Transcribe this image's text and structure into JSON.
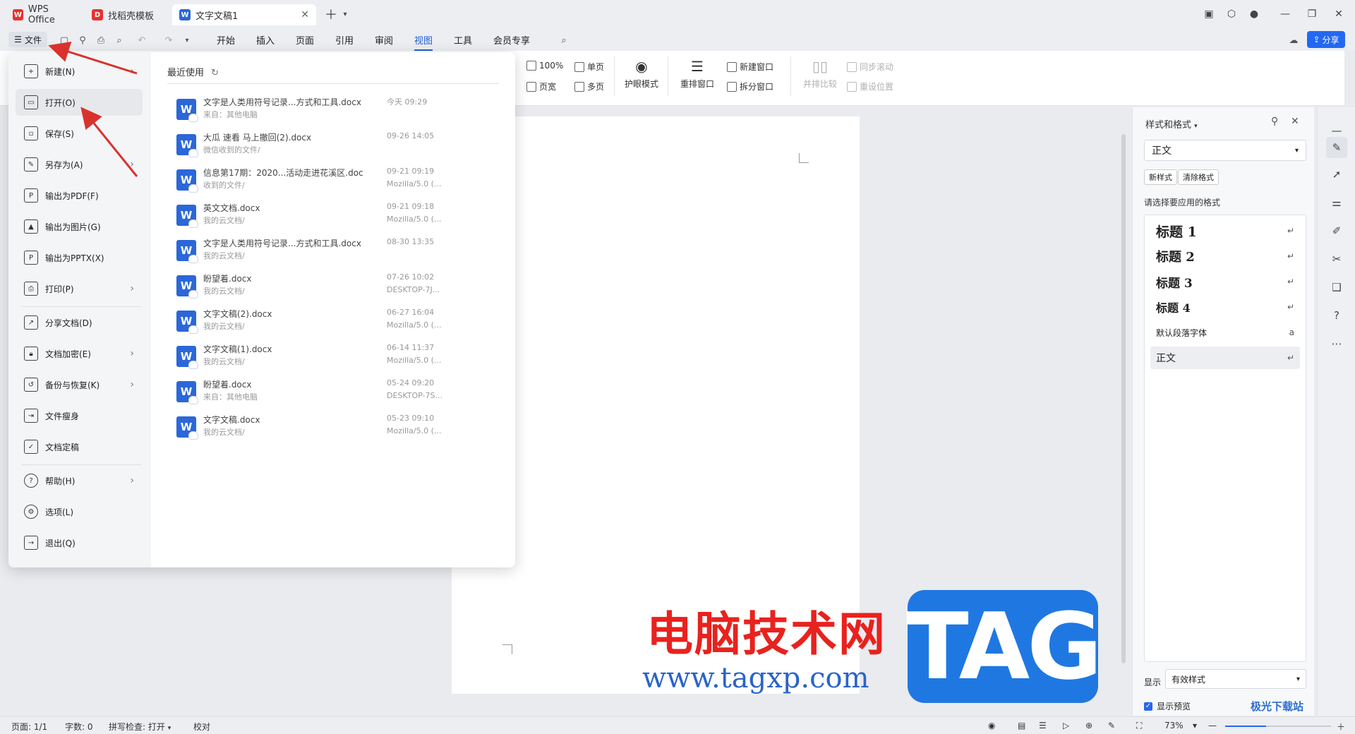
{
  "tabs": [
    {
      "label": "WPS Office",
      "icon": "wps-logo-icon"
    },
    {
      "label": "找稻壳模板",
      "icon": "docer-icon"
    },
    {
      "label": "文字文稿1",
      "icon": "word-doc-icon",
      "active": true
    }
  ],
  "menubar": {
    "file_label": "文件",
    "items": [
      "开始",
      "插入",
      "页面",
      "引用",
      "审阅",
      "视图",
      "工具",
      "会员专享"
    ],
    "active": "视图",
    "share_label": "分享"
  },
  "ribbon": {
    "zoom_100": "100%",
    "single_page": "单页",
    "page_width": "页宽",
    "multi_page": "多页",
    "eye_mode": "护眼模式",
    "rearrange_window": "重排窗口",
    "new_window": "新建窗口",
    "split_window": "拆分窗口",
    "side_by_side": "并排比较",
    "sync_scroll": "同步滚动",
    "reset_position": "重设位置"
  },
  "file_menu": {
    "items": [
      {
        "label": "新建(N)",
        "icon": "new-doc-icon",
        "arrow": true
      },
      {
        "label": "打开(O)",
        "icon": "folder-open-icon",
        "arrow": false
      },
      {
        "label": "保存(S)",
        "icon": "save-icon",
        "arrow": false
      },
      {
        "label": "另存为(A)",
        "icon": "save-as-icon",
        "arrow": true
      },
      {
        "label": "输出为PDF(F)",
        "icon": "pdf-icon",
        "arrow": false
      },
      {
        "label": "输出为图片(G)",
        "icon": "image-icon",
        "arrow": false
      },
      {
        "label": "输出为PPTX(X)",
        "icon": "pptx-icon",
        "arrow": false
      },
      {
        "label": "打印(P)",
        "icon": "printer-icon",
        "arrow": true
      },
      {
        "label": "分享文档(D)",
        "icon": "share-icon",
        "arrow": false
      },
      {
        "label": "文档加密(E)",
        "icon": "lock-doc-icon",
        "arrow": true
      },
      {
        "label": "备份与恢复(K)",
        "icon": "backup-icon",
        "arrow": true
      },
      {
        "label": "文件瘦身",
        "icon": "slim-icon",
        "arrow": false
      },
      {
        "label": "文档定稿",
        "icon": "finalize-icon",
        "arrow": false
      },
      {
        "label": "帮助(H)",
        "icon": "help-icon",
        "arrow": true
      },
      {
        "label": "选项(L)",
        "icon": "gear-icon",
        "arrow": false
      },
      {
        "label": "退出(Q)",
        "icon": "exit-icon",
        "arrow": false
      }
    ],
    "recent_title": "最近使用",
    "recent": [
      {
        "name": "文字是人类用符号记录...方式和工具.docx",
        "source": "来自：其他电脑",
        "time": "今天  09:29",
        "device": ""
      },
      {
        "name": "大瓜 速看 马上撤回(2).docx",
        "source": "微信收到的文件/",
        "time": "09-26 14:05",
        "device": ""
      },
      {
        "name": "信息第17期：2020...活动走进花溪区.doc",
        "source": "收到的文件/",
        "time": "09-21 09:19",
        "device": "Mozilla/5.0 (..."
      },
      {
        "name": "英文文档.docx",
        "source": "我的云文档/",
        "time": "09-21 09:18",
        "device": "Mozilla/5.0 (..."
      },
      {
        "name": "文字是人类用符号记录...方式和工具.docx",
        "source": "我的云文档/",
        "time": "08-30 13:35",
        "device": ""
      },
      {
        "name": "盼望着.docx",
        "source": "我的云文档/",
        "time": "07-26 10:02",
        "device": "DESKTOP-7J..."
      },
      {
        "name": "文字文稿(2).docx",
        "source": "我的云文档/",
        "time": "06-27 16:04",
        "device": "Mozilla/5.0 (..."
      },
      {
        "name": "文字文稿(1).docx",
        "source": "我的云文档/",
        "time": "06-14 11:37",
        "device": "Mozilla/5.0 (..."
      },
      {
        "name": "盼望着.docx",
        "source": "来自：其他电脑",
        "time": "05-24 09:20",
        "device": "DESKTOP-7S..."
      },
      {
        "name": "文字文稿.docx",
        "source": "我的云文档/",
        "time": "05-23 09:10",
        "device": "Mozilla/5.0 (..."
      }
    ]
  },
  "panel": {
    "title": "样式和格式",
    "current_style": "正文",
    "new_style": "新样式",
    "clear_format": "清除格式",
    "apply_label": "请选择要应用的格式",
    "styles": [
      {
        "label": "标题  1",
        "size": 19,
        "bold": true,
        "mark": "↵"
      },
      {
        "label": "标题  2",
        "size": 18,
        "bold": true,
        "mark": "↵"
      },
      {
        "label": "标题  3",
        "size": 17,
        "bold": true,
        "mark": "↵"
      },
      {
        "label": "标题  4",
        "size": 16,
        "bold": true,
        "mark": "↵"
      },
      {
        "label": "默认段落字体",
        "size": 12,
        "bold": false,
        "mark": "a"
      },
      {
        "label": "正文",
        "size": 14,
        "bold": false,
        "mark": "↵",
        "selected": true
      }
    ],
    "display_label": "显示",
    "display_value": "有效样式",
    "preview_label": "显示预览"
  },
  "status": {
    "page": "页面: 1/1",
    "words": "字数: 0",
    "spell": "拼写检查: 打开",
    "proof": "校对",
    "zoom": "73%"
  },
  "watermark": {
    "cn": "电脑技术网",
    "url": "www.tagxp.com",
    "tag": "TAG",
    "brand": "极光下载站"
  }
}
